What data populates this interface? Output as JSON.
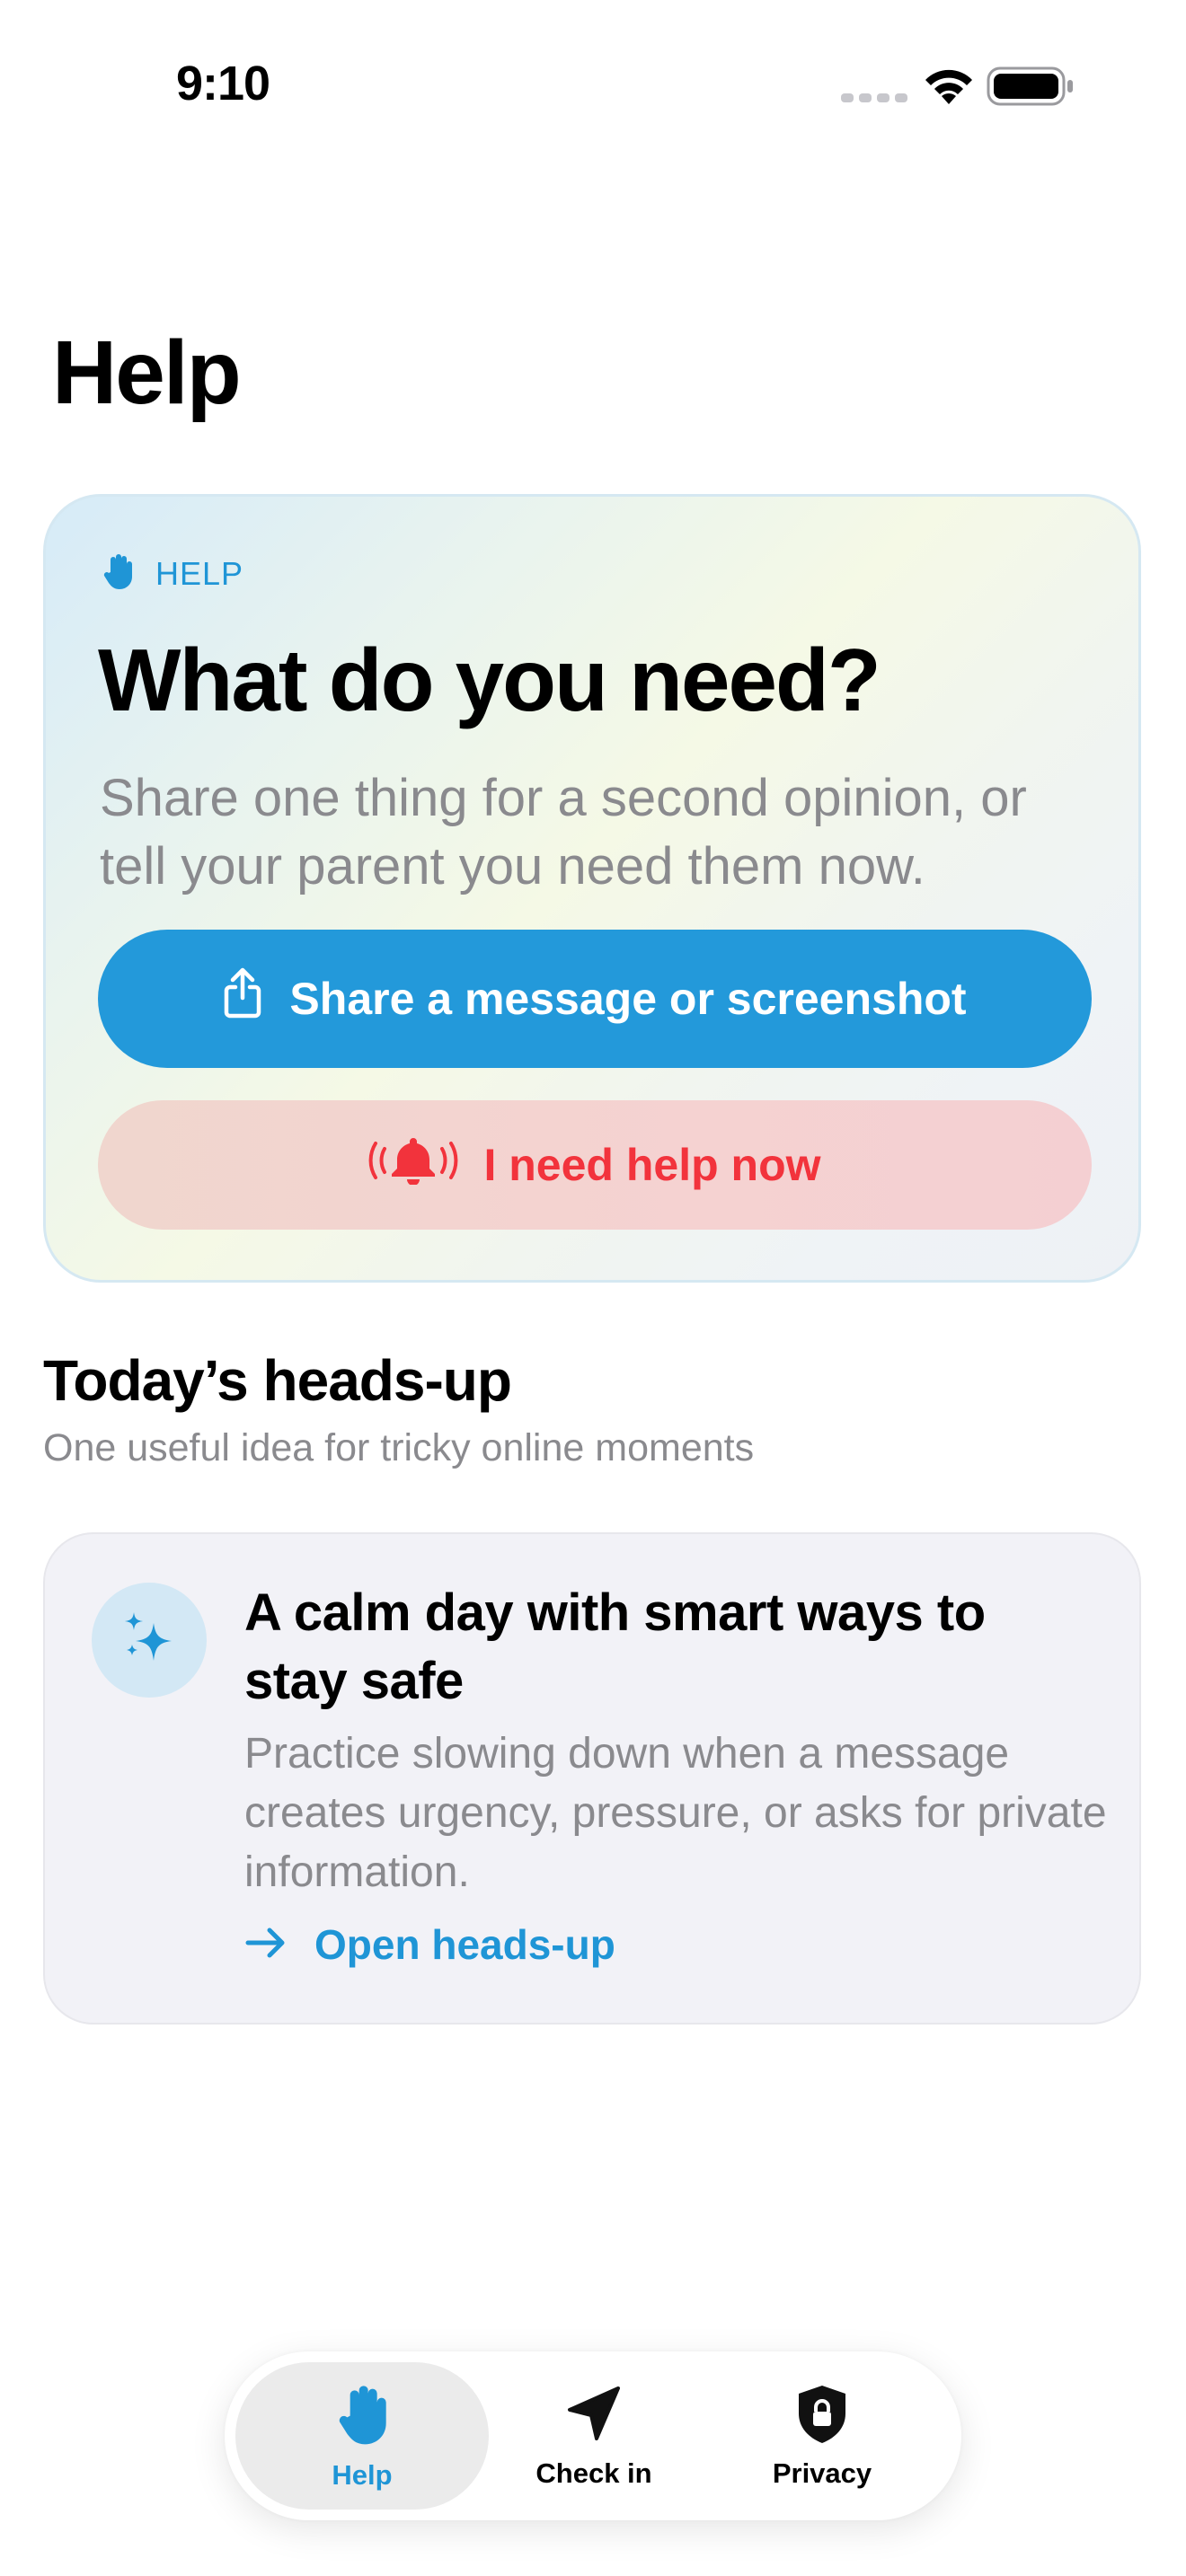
{
  "status_bar": {
    "time": "9:10"
  },
  "page": {
    "title": "Help"
  },
  "hero": {
    "tag_icon": "hand-raised-icon",
    "tag_label": "HELP",
    "title": "What do you need?",
    "subtitle": "Share one thing for a second opinion, or tell your parent you need them now.",
    "share_button": {
      "icon": "share-icon",
      "label": "Share a message or screenshot"
    },
    "help_button": {
      "icon": "alarm-bell-icon",
      "label": "I need help now"
    }
  },
  "headsup": {
    "title": "Today’s heads-up",
    "subtitle": "One useful idea for tricky online moments",
    "card": {
      "icon": "sparkles-icon",
      "title": "A calm day with smart ways to stay safe",
      "body": "Practice slowing down when a message creates urgency, pressure, or asks for private information.",
      "link_icon": "arrow-right-icon",
      "link_label": "Open heads-up"
    }
  },
  "tab_bar": {
    "tabs": [
      {
        "icon": "hand-raised-icon",
        "label": "Help",
        "active": true
      },
      {
        "icon": "location-arrow-icon",
        "label": "Check in",
        "active": false
      },
      {
        "icon": "lock-shield-icon",
        "label": "Privacy",
        "active": false
      }
    ]
  },
  "colors": {
    "accent": "#2399DA",
    "danger": "#F2333C",
    "secondary_text": "#8A8A8E"
  }
}
